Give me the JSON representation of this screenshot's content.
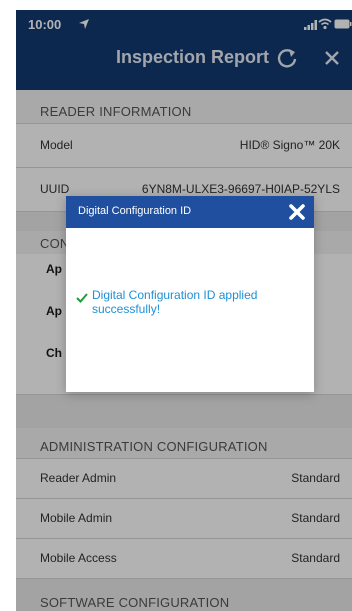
{
  "statusbar": {
    "time": "10:00"
  },
  "header": {
    "title": "Inspection Report"
  },
  "sections": {
    "reader_info": {
      "title": "READER INFORMATION",
      "rows": [
        {
          "label": "Model",
          "value": "HID® Signo™ 20K"
        },
        {
          "label": "UUID",
          "value": "6YN8M-ULXE3-96697-H0IAP-52YLS"
        }
      ]
    },
    "partially_hidden": {
      "title_fragment": "CON",
      "row_fragments": [
        "Ap",
        "Ap",
        "Ch"
      ]
    },
    "admin_config": {
      "title": "ADMINISTRATION CONFIGURATION",
      "rows": [
        {
          "label": "Reader Admin",
          "value": "Standard"
        },
        {
          "label": "Mobile Admin",
          "value": "Standard"
        },
        {
          "label": "Mobile Access",
          "value": "Standard"
        }
      ]
    },
    "software_config": {
      "title": "SOFTWARE CONFIGURATION"
    }
  },
  "dialog": {
    "title": "Digital Configuration ID",
    "message": "Digital Configuration ID applied successfully!"
  },
  "colors": {
    "header_bg": "#123a72",
    "dialog_header_bg": "#1f4f9e",
    "message_text": "#1e90d6",
    "check_icon": "#1e9e3a"
  }
}
